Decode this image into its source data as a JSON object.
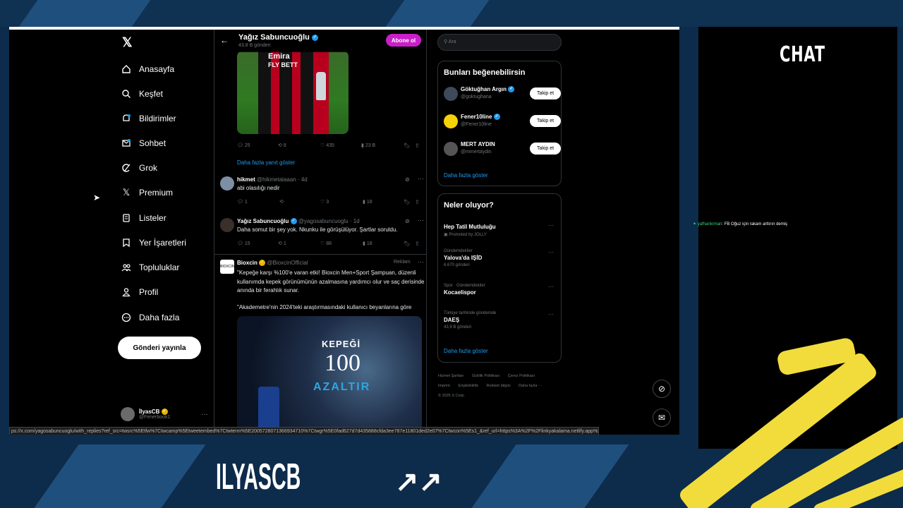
{
  "profile_header": {
    "name": "Yağız Sabuncuoğlu",
    "post_count": "43,8 B gönderi",
    "subscribe_label": "Abone ol"
  },
  "image_tweet": {
    "jersey_text": "Emira\nFLY BETT",
    "actions": {
      "replies": "25",
      "reposts": "8",
      "likes": "435",
      "views": "23 B"
    }
  },
  "more_replies_label": "Daha fazla yanıt göster",
  "replies": [
    {
      "name": "hikmet",
      "handle": "@hikmetalaaan · 4d",
      "text": "abi olasılığı nedir",
      "actions": {
        "replies": "1",
        "reposts": "",
        "likes": "3",
        "views": "18"
      }
    },
    {
      "name": "Yağız Sabuncuoğlu",
      "handle": "@yagosabuncuoglu · 1d",
      "text": "Daha somut bir şey yok. Nkunku ile görüşülüyor. Şartlar soruldu.",
      "actions": {
        "replies": "15",
        "reposts": "1",
        "likes": "88",
        "views": "18"
      }
    }
  ],
  "ad": {
    "name": "Bioxcin",
    "handle": "@BioxcinOfficial",
    "tag": "Reklam",
    "text": "\"Kepeğe karşı %100'e varan etki! Bioxcin Men+Sport Şampuan, düzenli kullanımda kepek görünümünün azalmasına yardımcı olur ve saç derisinde anında bir ferahlık sunar.",
    "text2": "\"Akademetre'nin 2024'teki araştırmasındaki kullanıcı beyanlarına göre",
    "image_line1": "KEPEĞİ",
    "image_line2": "100",
    "image_line3": "AZALTIR"
  },
  "nav": {
    "items": [
      {
        "label": "Anasayfa",
        "icon": "home-icon"
      },
      {
        "label": "Keşfet",
        "icon": "search-icon"
      },
      {
        "label": "Bildirimler",
        "icon": "bell-icon"
      },
      {
        "label": "Sohbet",
        "icon": "mail-icon"
      },
      {
        "label": "Grok",
        "icon": "grok-icon"
      },
      {
        "label": "Premium",
        "icon": "x-icon"
      },
      {
        "label": "Listeler",
        "icon": "list-icon"
      },
      {
        "label": "Yer İşaretleri",
        "icon": "bookmark-icon"
      },
      {
        "label": "Topluluklar",
        "icon": "people-icon"
      },
      {
        "label": "Profil",
        "icon": "person-icon"
      },
      {
        "label": "Daha fazla",
        "icon": "more-circle-icon"
      }
    ],
    "post_label": "Gönderi yayınla",
    "me_name": "İlyasCB",
    "me_handle": "@Fenerbook1"
  },
  "right": {
    "search_placeholder": "Ara",
    "suggest_title": "Bunları beğenebilirsin",
    "suggestions": [
      {
        "name": "Göktuğhan Argın",
        "handle": "@goktughana",
        "follow": "Takip et"
      },
      {
        "name": "Fener10line",
        "handle": "@Fener10line",
        "follow": "Takip et"
      },
      {
        "name": "MERT AYDIN",
        "handle": "@mmertaydin",
        "follow": "Takip et"
      }
    ],
    "show_more": "Daha fazla göster",
    "trends_title": "Neler oluyor?",
    "trends": [
      {
        "category": "",
        "title": "Hep Tatil Mutluluğu",
        "sub": "Promoted by JOLLY"
      },
      {
        "category": "Gündemdekiler",
        "title": "Yalova'da IŞİD",
        "sub": "6.670 gönderi"
      },
      {
        "category": "Spor · Gündemdekiler",
        "title": "Kocaelispor",
        "sub": ""
      },
      {
        "category": "Türkiye tarihinde gündemde",
        "title": "DAEŞ",
        "sub": "43,9 B gönderi"
      }
    ],
    "trends_more": "Daha fazla göster",
    "footer": [
      "Hizmet Şartları",
      "Gizlilik Politikası",
      "Çerez Politikası",
      "Imprint",
      "Erişilebilirlik",
      "Reklam bilgisi",
      "Daha fazla ···",
      "© 2025 X Corp."
    ]
  },
  "status_url": "ps://x.com/yagosabuncuoglu/with_replies?ref_src=twsrc%5Etfw%7Ctwcamp%5Etweetembed%7Ctwterm%5E2005728071366934710%7Ctwgr%5E0fad627d7d435888cfda3ee787e11801ded2e07%7Ctwcon%5Es1_&ref_url=https%3A%2F%2Flinkyakalama.netlify.app%2F",
  "chat": {
    "title": "CHAT",
    "message_user": "yafhankrman",
    "message_text": ": FB Oğuz için rakam arttırın demiş"
  },
  "overlay": {
    "brand_left": "ILYASCB",
    "brand_right": "↗↗"
  }
}
